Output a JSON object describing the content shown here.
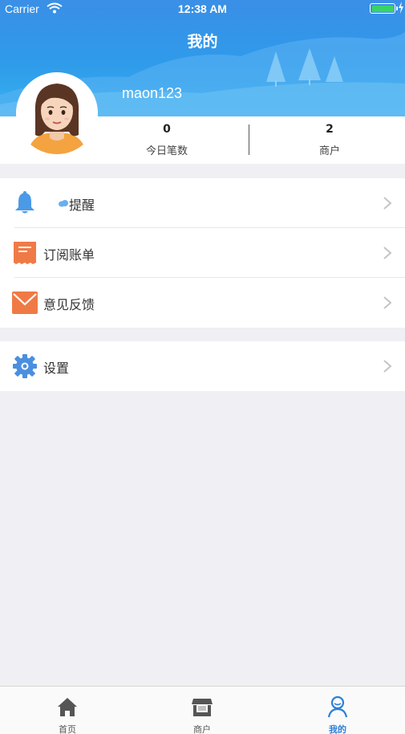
{
  "status_bar": {
    "carrier": "Carrier",
    "time": "12:38 AM"
  },
  "header": {
    "title": "我的",
    "username": "maon123"
  },
  "stats": [
    {
      "value": "0",
      "label": "今日笔数"
    },
    {
      "value": "2",
      "label": "商户"
    }
  ],
  "menu_group_1": [
    {
      "label": "提醒",
      "icon": "bell-icon"
    },
    {
      "label": "订阅账单",
      "icon": "receipt-icon"
    },
    {
      "label": "意见反馈",
      "icon": "envelope-icon"
    }
  ],
  "menu_group_2": [
    {
      "label": "设置",
      "icon": "gear-icon"
    }
  ],
  "tabbar": [
    {
      "label": "首页",
      "icon": "home-icon"
    },
    {
      "label": "商户",
      "icon": "store-icon"
    },
    {
      "label": "我的",
      "icon": "profile-icon",
      "active": true
    }
  ],
  "colors": {
    "header": "#3a8fe6",
    "accent": "#2c7fd8",
    "background": "#efeff4"
  }
}
